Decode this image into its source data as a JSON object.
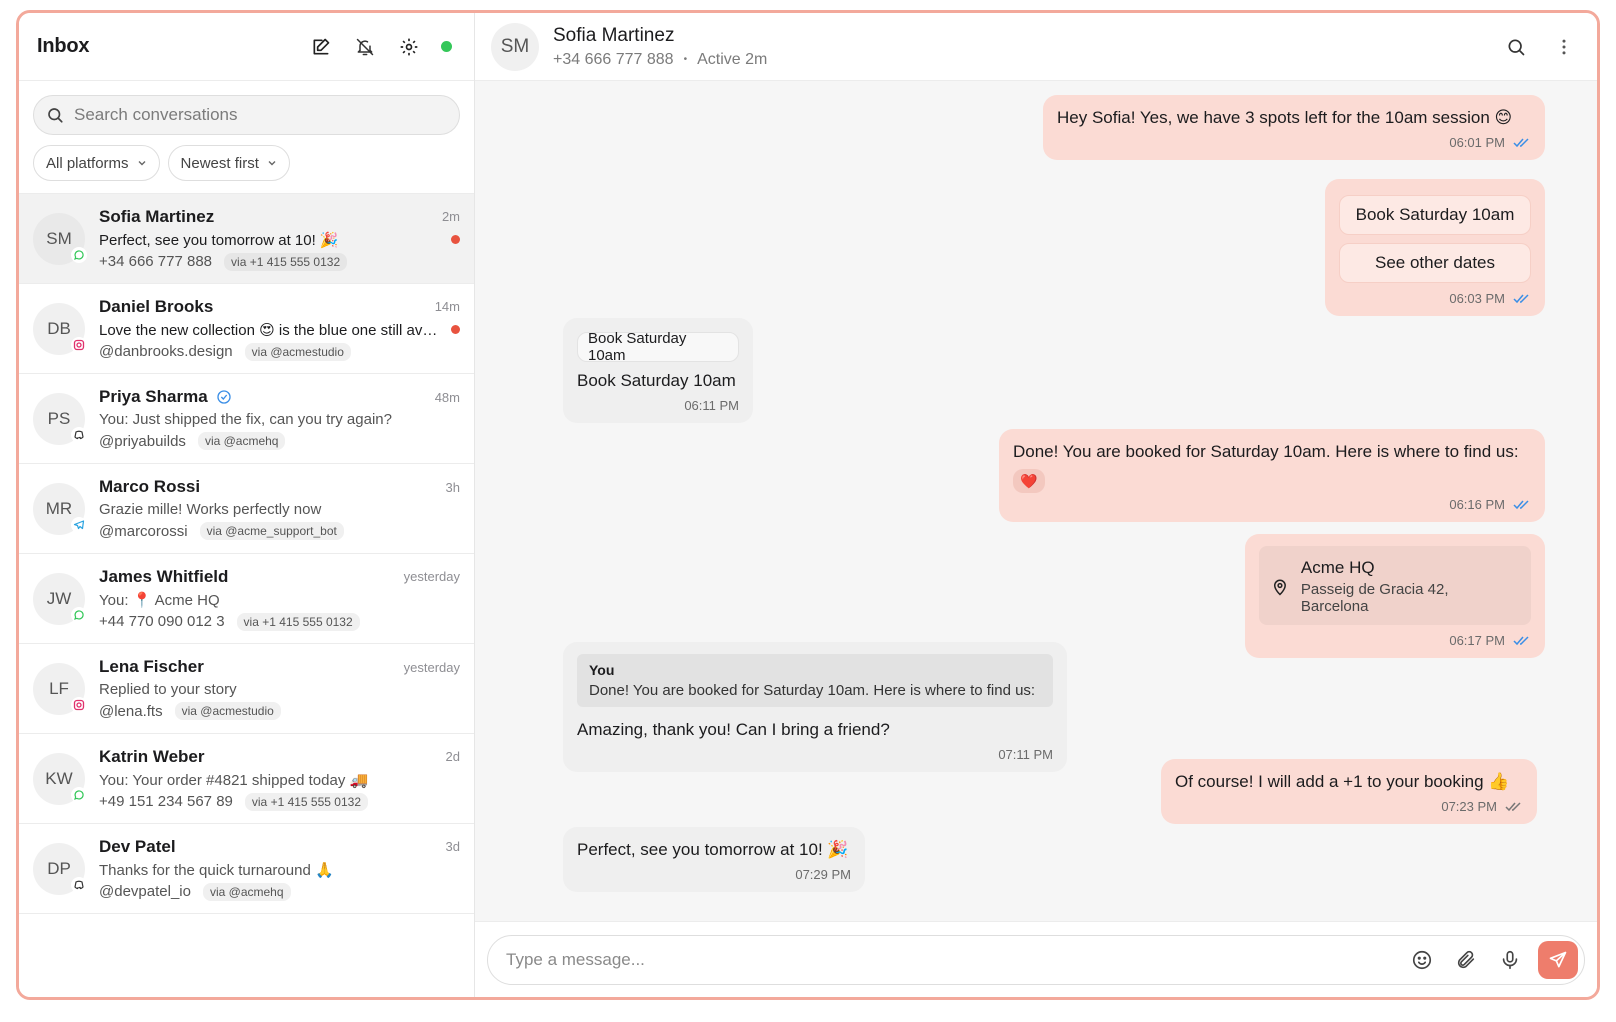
{
  "sidebar": {
    "title": "Inbox",
    "search_placeholder": "Search conversations",
    "filters": [
      "All platforms",
      "Newest first"
    ],
    "conversations": [
      {
        "initials": "SM",
        "name": "Sofia Martinez",
        "time": "2m",
        "preview": "Perfect, see you tomorrow at 10! 🎉",
        "handle": "+34 666 777 888",
        "via": "via +1 415 555 0132",
        "platform": "whatsapp",
        "unread": true,
        "active": true,
        "verified": false
      },
      {
        "initials": "DB",
        "name": "Daniel Brooks",
        "time": "14m",
        "preview": "Love the new collection 😍 is the blue one still available?",
        "handle": "@danbrooks.design",
        "via": "via @acmestudio",
        "platform": "instagram",
        "unread": true,
        "active": false,
        "verified": false
      },
      {
        "initials": "PS",
        "name": "Priya Sharma",
        "time": "48m",
        "preview": "You: Just shipped the fix, can you try again?",
        "handle": "@priyabuilds",
        "via": "via @acmehq",
        "platform": "discord",
        "unread": false,
        "active": false,
        "verified": true
      },
      {
        "initials": "MR",
        "name": "Marco Rossi",
        "time": "3h",
        "preview": "Grazie mille! Works perfectly now",
        "handle": "@marcorossi",
        "via": "via @acme_support_bot",
        "platform": "telegram",
        "unread": false,
        "active": false,
        "verified": false
      },
      {
        "initials": "JW",
        "name": "James Whitfield",
        "time": "yesterday",
        "preview": "You: 📍 Acme HQ",
        "handle": "+44 770 090 012 3",
        "via": "via +1 415 555 0132",
        "platform": "whatsapp",
        "unread": false,
        "active": false,
        "verified": false
      },
      {
        "initials": "LF",
        "name": "Lena Fischer",
        "time": "yesterday",
        "preview": "Replied to your story",
        "handle": "@lena.fts",
        "via": "via @acmestudio",
        "platform": "instagram",
        "unread": false,
        "active": false,
        "verified": false
      },
      {
        "initials": "KW",
        "name": "Katrin Weber",
        "time": "2d",
        "preview": "You: Your order #4821 shipped today 🚚",
        "handle": "+49 151 234 567 89",
        "via": "via +1 415 555 0132",
        "platform": "whatsapp",
        "unread": false,
        "active": false,
        "verified": false
      },
      {
        "initials": "DP",
        "name": "Dev Patel",
        "time": "3d",
        "preview": "Thanks for the quick turnaround 🙏",
        "handle": "@devpatel_io",
        "via": "via @acmehq",
        "platform": "discord",
        "unread": false,
        "active": false,
        "verified": false
      }
    ]
  },
  "chat": {
    "initials": "SM",
    "name": "Sofia Martinez",
    "phone": "+34 666 777 888",
    "separator": "•",
    "status": "Active 2m",
    "messages": {
      "m1": {
        "text": "Hey Sofia! Yes, we have 3 spots left for the 10am session 😊",
        "time": "06:01 PM"
      },
      "m2": {
        "buttons": [
          "Book Saturday 10am",
          "See other dates"
        ],
        "time": "06:03 PM"
      },
      "m3": {
        "chip": "Book Saturday 10am",
        "text": "Book Saturday 10am",
        "time": "06:11 PM"
      },
      "m4": {
        "text": "Done! You are booked for Saturday 10am. Here is where to find us:",
        "reaction": "❤️",
        "time": "06:16 PM"
      },
      "m5": {
        "place": "Acme HQ",
        "address": "Passeig de Gracia 42, Barcelona",
        "time": "06:17 PM"
      },
      "m6": {
        "quote_author": "You",
        "quote_text": "Done! You are booked for Saturday 10am. Here is where to find us:",
        "text": "Amazing, thank you! Can I bring a friend?",
        "time": "07:11 PM"
      },
      "m7": {
        "text": "Of course! I will add a +1 to your booking 👍",
        "time": "07:23 PM"
      },
      "m8": {
        "text": "Perfect, see you tomorrow at 10! 🎉",
        "time": "07:29 PM"
      }
    }
  },
  "composer": {
    "placeholder": "Type a message..."
  },
  "colors": {
    "accent": "#ee7d6c",
    "outgoing_bubble": "#fbdbd4",
    "incoming_bubble": "#efefef",
    "unread_dot": "#e8533f",
    "online": "#34c759",
    "frame_border": "#f3a99b"
  }
}
